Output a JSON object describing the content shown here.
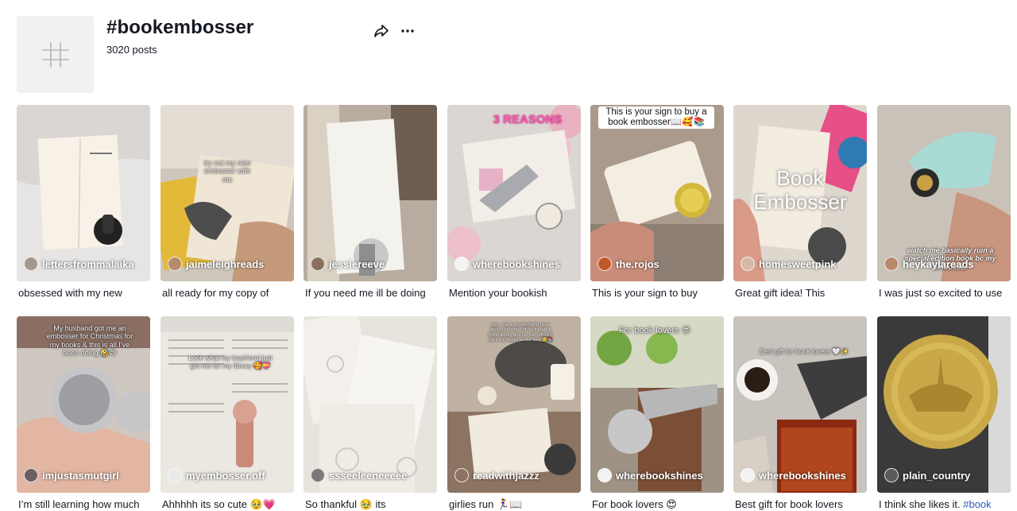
{
  "hashtag": {
    "title": "#bookembosser",
    "post_count": "3020 posts",
    "icon": "hashtag-icon",
    "actions": [
      "share-icon",
      "more-icon"
    ]
  },
  "videos": [
    {
      "creator": "lettersfrommalaika",
      "caption": "obsessed with my new",
      "overlay": ""
    },
    {
      "creator": "jaimeleighreads",
      "caption": "all ready for my copy of",
      "overlay": "try out my new embosser with me"
    },
    {
      "creator": "jessiereeve",
      "caption": "If you need me ill be doing",
      "overlay": ""
    },
    {
      "creator": "wherebookshines",
      "caption": "Mention your bookish",
      "overlay": "3 REASONS"
    },
    {
      "creator": "the.rojos",
      "caption": "This is your sign to buy",
      "overlay": "This is your sign to buy a book embosser📖🥰📚"
    },
    {
      "creator": "homesweetpink",
      "caption": "Great gift idea! This",
      "overlay": "Book Embosser"
    },
    {
      "creator": "heykaylareads",
      "caption": "I was just so excited to use",
      "overlay": "watch me basically ruin a special edition book bc my embosser"
    },
    {
      "creator": "imjustasmutgirl",
      "caption": "I’m still learning how much",
      "overlay": "My husband got me an embosser for Christmas for my books & this is all I’ve been doing 🤣😅"
    },
    {
      "creator": "myembosser.off",
      "caption": "Ahhhhh its so cute 🥹💗",
      "overlay": "Look what my boyfriend just got me for my library 🥰💝"
    },
    {
      "creator": "ssseeleeneeeee",
      "caption": "So thankful 🥹 its",
      "overlay": ""
    },
    {
      "creator": "readwithjazzz",
      "caption": "girlies run 🏃‍♀️📖",
      "overlay": "pov - me & my boyfriend have always dreamed of having an at home library and we can officially mark our books as our own 🥹📚"
    },
    {
      "creator": "wherebookshines",
      "caption": "For book lovers 😍",
      "overlay": "For book lovers 😍"
    },
    {
      "creator": "wherebookshines",
      "caption": "Best gift for book lovers",
      "overlay": "Best gift for book lovers 🤍✨"
    },
    {
      "creator": "plain_country",
      "caption": "I think she likes it.",
      "caption_tag": "#book",
      "overlay": ""
    }
  ],
  "colors": {
    "accent_link": "#2b5db9",
    "text": "#161823",
    "placeholder": "#f1f1f2"
  }
}
